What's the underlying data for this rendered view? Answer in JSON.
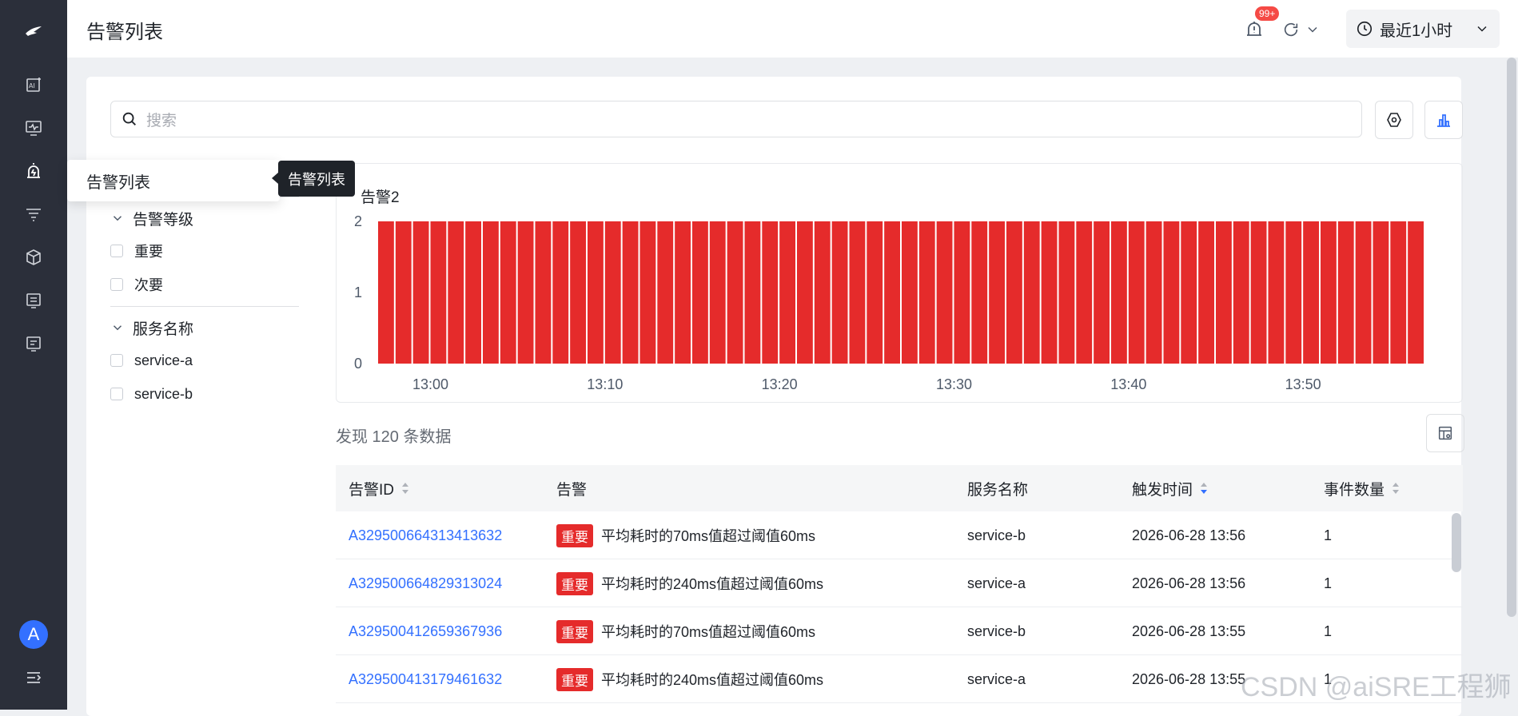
{
  "header": {
    "title": "告警列表",
    "notification_badge": "99+",
    "time_range": "最近1小时"
  },
  "sidebar": {
    "avatar_letter": "A",
    "icons": [
      "logo-icon",
      "ai-analysis-icon",
      "monitor-icon",
      "alarm-icon",
      "filter-list-icon",
      "cube-icon",
      "list-icon",
      "list-alt-icon",
      "collapse-icon"
    ]
  },
  "menu_popup": {
    "label": "告警列表",
    "tooltip": "告警列表"
  },
  "search": {
    "placeholder": "搜索"
  },
  "filters": {
    "groups": [
      {
        "title": "告警等级",
        "options": [
          "重要",
          "次要"
        ]
      },
      {
        "title": "服务名称",
        "options": [
          "service-a",
          "service-b"
        ]
      }
    ]
  },
  "chart_data": {
    "type": "bar",
    "legend": "告警2",
    "y_ticks": [
      "2",
      "1",
      "0"
    ],
    "ylim": [
      0,
      2
    ],
    "x_tick_labels": [
      "13:00",
      "13:10",
      "13:20",
      "13:30",
      "13:40",
      "13:50"
    ],
    "bar_count": 60,
    "values": [
      2,
      2,
      2,
      2,
      2,
      2,
      2,
      2,
      2,
      2,
      2,
      2,
      2,
      2,
      2,
      2,
      2,
      2,
      2,
      2,
      2,
      2,
      2,
      2,
      2,
      2,
      2,
      2,
      2,
      2,
      2,
      2,
      2,
      2,
      2,
      2,
      2,
      2,
      2,
      2,
      2,
      2,
      2,
      2,
      2,
      2,
      2,
      2,
      2,
      2,
      2,
      2,
      2,
      2,
      2,
      2,
      2,
      2,
      2,
      2
    ],
    "color": "#e52b2b"
  },
  "result_count": "发现 120 条数据",
  "table": {
    "columns": [
      "告警ID",
      "告警",
      "服务名称",
      "触发时间",
      "事件数量"
    ],
    "rows": [
      {
        "id": "A329500664313413632",
        "level": "重要",
        "alert": "平均耗时的70ms值超过阈值60ms",
        "service": "service-b",
        "time": "2026-06-28 13:56",
        "count": "1"
      },
      {
        "id": "A329500664829313024",
        "level": "重要",
        "alert": "平均耗时的240ms值超过阈值60ms",
        "service": "service-a",
        "time": "2026-06-28 13:56",
        "count": "1"
      },
      {
        "id": "A329500412659367936",
        "level": "重要",
        "alert": "平均耗时的70ms值超过阈值60ms",
        "service": "service-b",
        "time": "2026-06-28 13:55",
        "count": "1"
      },
      {
        "id": "A329500413179461632",
        "level": "重要",
        "alert": "平均耗时的240ms值超过阈值60ms",
        "service": "service-a",
        "time": "2026-06-28 13:55",
        "count": "1"
      }
    ]
  },
  "watermark": "CSDN @aiSRE工程狮"
}
